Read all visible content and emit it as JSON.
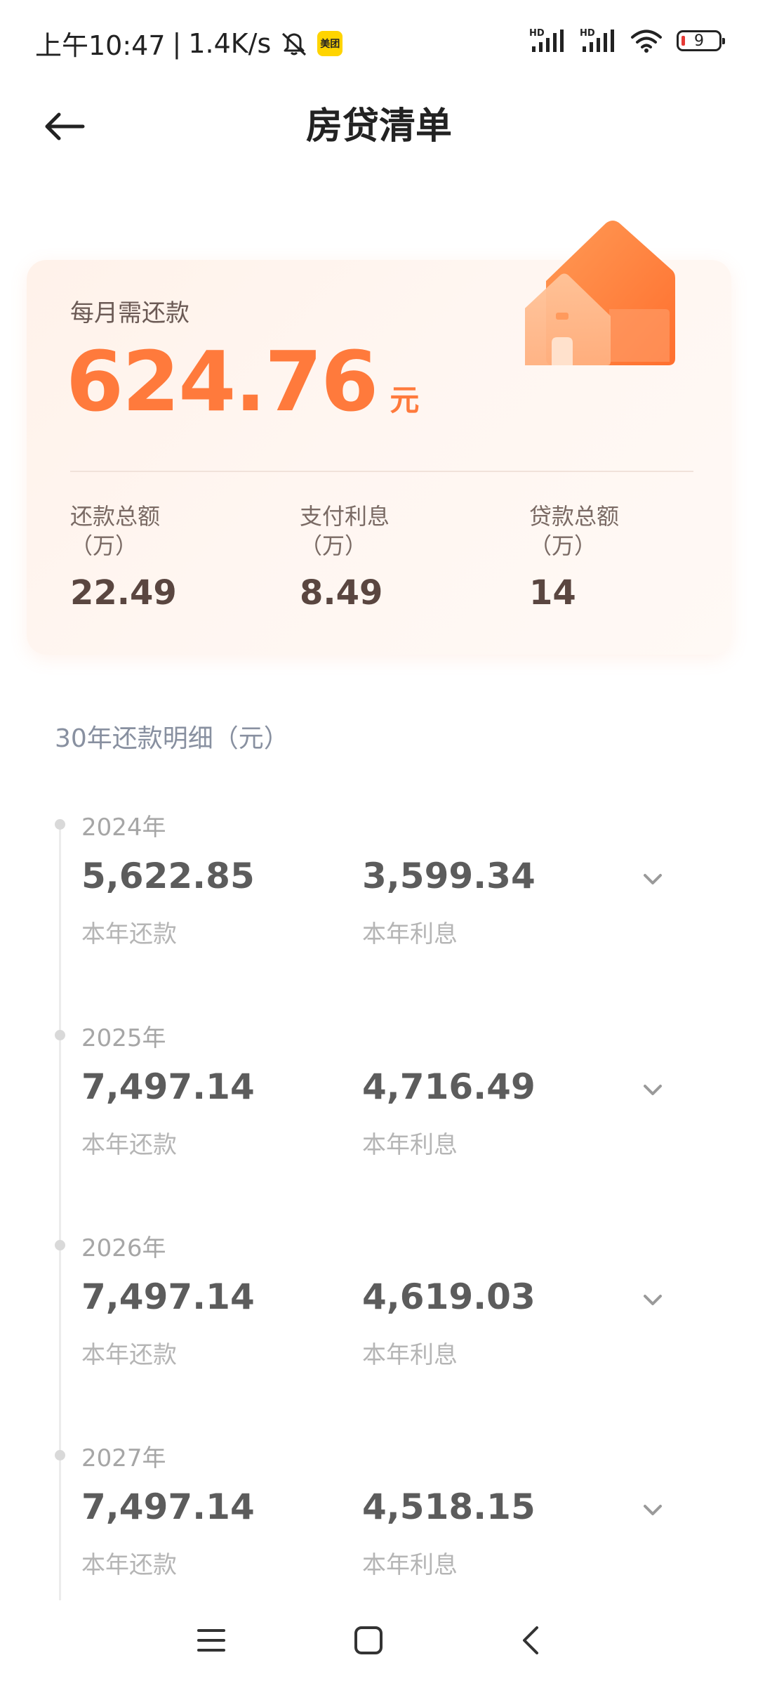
{
  "status_bar": {
    "time": "上午10:47",
    "separator": "|",
    "speed": "1.4K/s",
    "app_badge": "美团",
    "signal_label_1": "HD",
    "signal_label_2": "HD",
    "battery": "9",
    "battery_color": "#e53935",
    "icons": [
      "mute-icon",
      "meituan-icon",
      "signal-icon",
      "signal-icon",
      "wifi-icon",
      "battery-icon"
    ]
  },
  "header": {
    "title": "房贷清单",
    "back_icon": "arrow-left-icon"
  },
  "summary": {
    "monthly_label": "每月需还款",
    "monthly_amount": "624.76",
    "monthly_unit": "元",
    "accent_color": "#ff7a3c",
    "stats": [
      {
        "label": "还款总额",
        "unit": "（万）",
        "value": "22.49"
      },
      {
        "label": "支付利息",
        "unit": "（万）",
        "value": "8.49"
      },
      {
        "label": "贷款总额",
        "unit": "（万）",
        "value": "14"
      }
    ]
  },
  "detail": {
    "title": "30年还款明细（元）",
    "years": [
      {
        "year": "2024年",
        "repay": "5,622.85",
        "repay_label": "本年还款",
        "interest": "3,599.34",
        "interest_label": "本年利息"
      },
      {
        "year": "2025年",
        "repay": "7,497.14",
        "repay_label": "本年还款",
        "interest": "4,716.49",
        "interest_label": "本年利息"
      },
      {
        "year": "2026年",
        "repay": "7,497.14",
        "repay_label": "本年还款",
        "interest": "4,619.03",
        "interest_label": "本年利息"
      },
      {
        "year": "2027年",
        "repay": "7,497.14",
        "repay_label": "本年还款",
        "interest": "4,518.15",
        "interest_label": "本年利息"
      }
    ]
  },
  "nav_bar": {
    "icons": [
      "menu-icon",
      "home-square-icon",
      "back-chevron-icon"
    ]
  }
}
